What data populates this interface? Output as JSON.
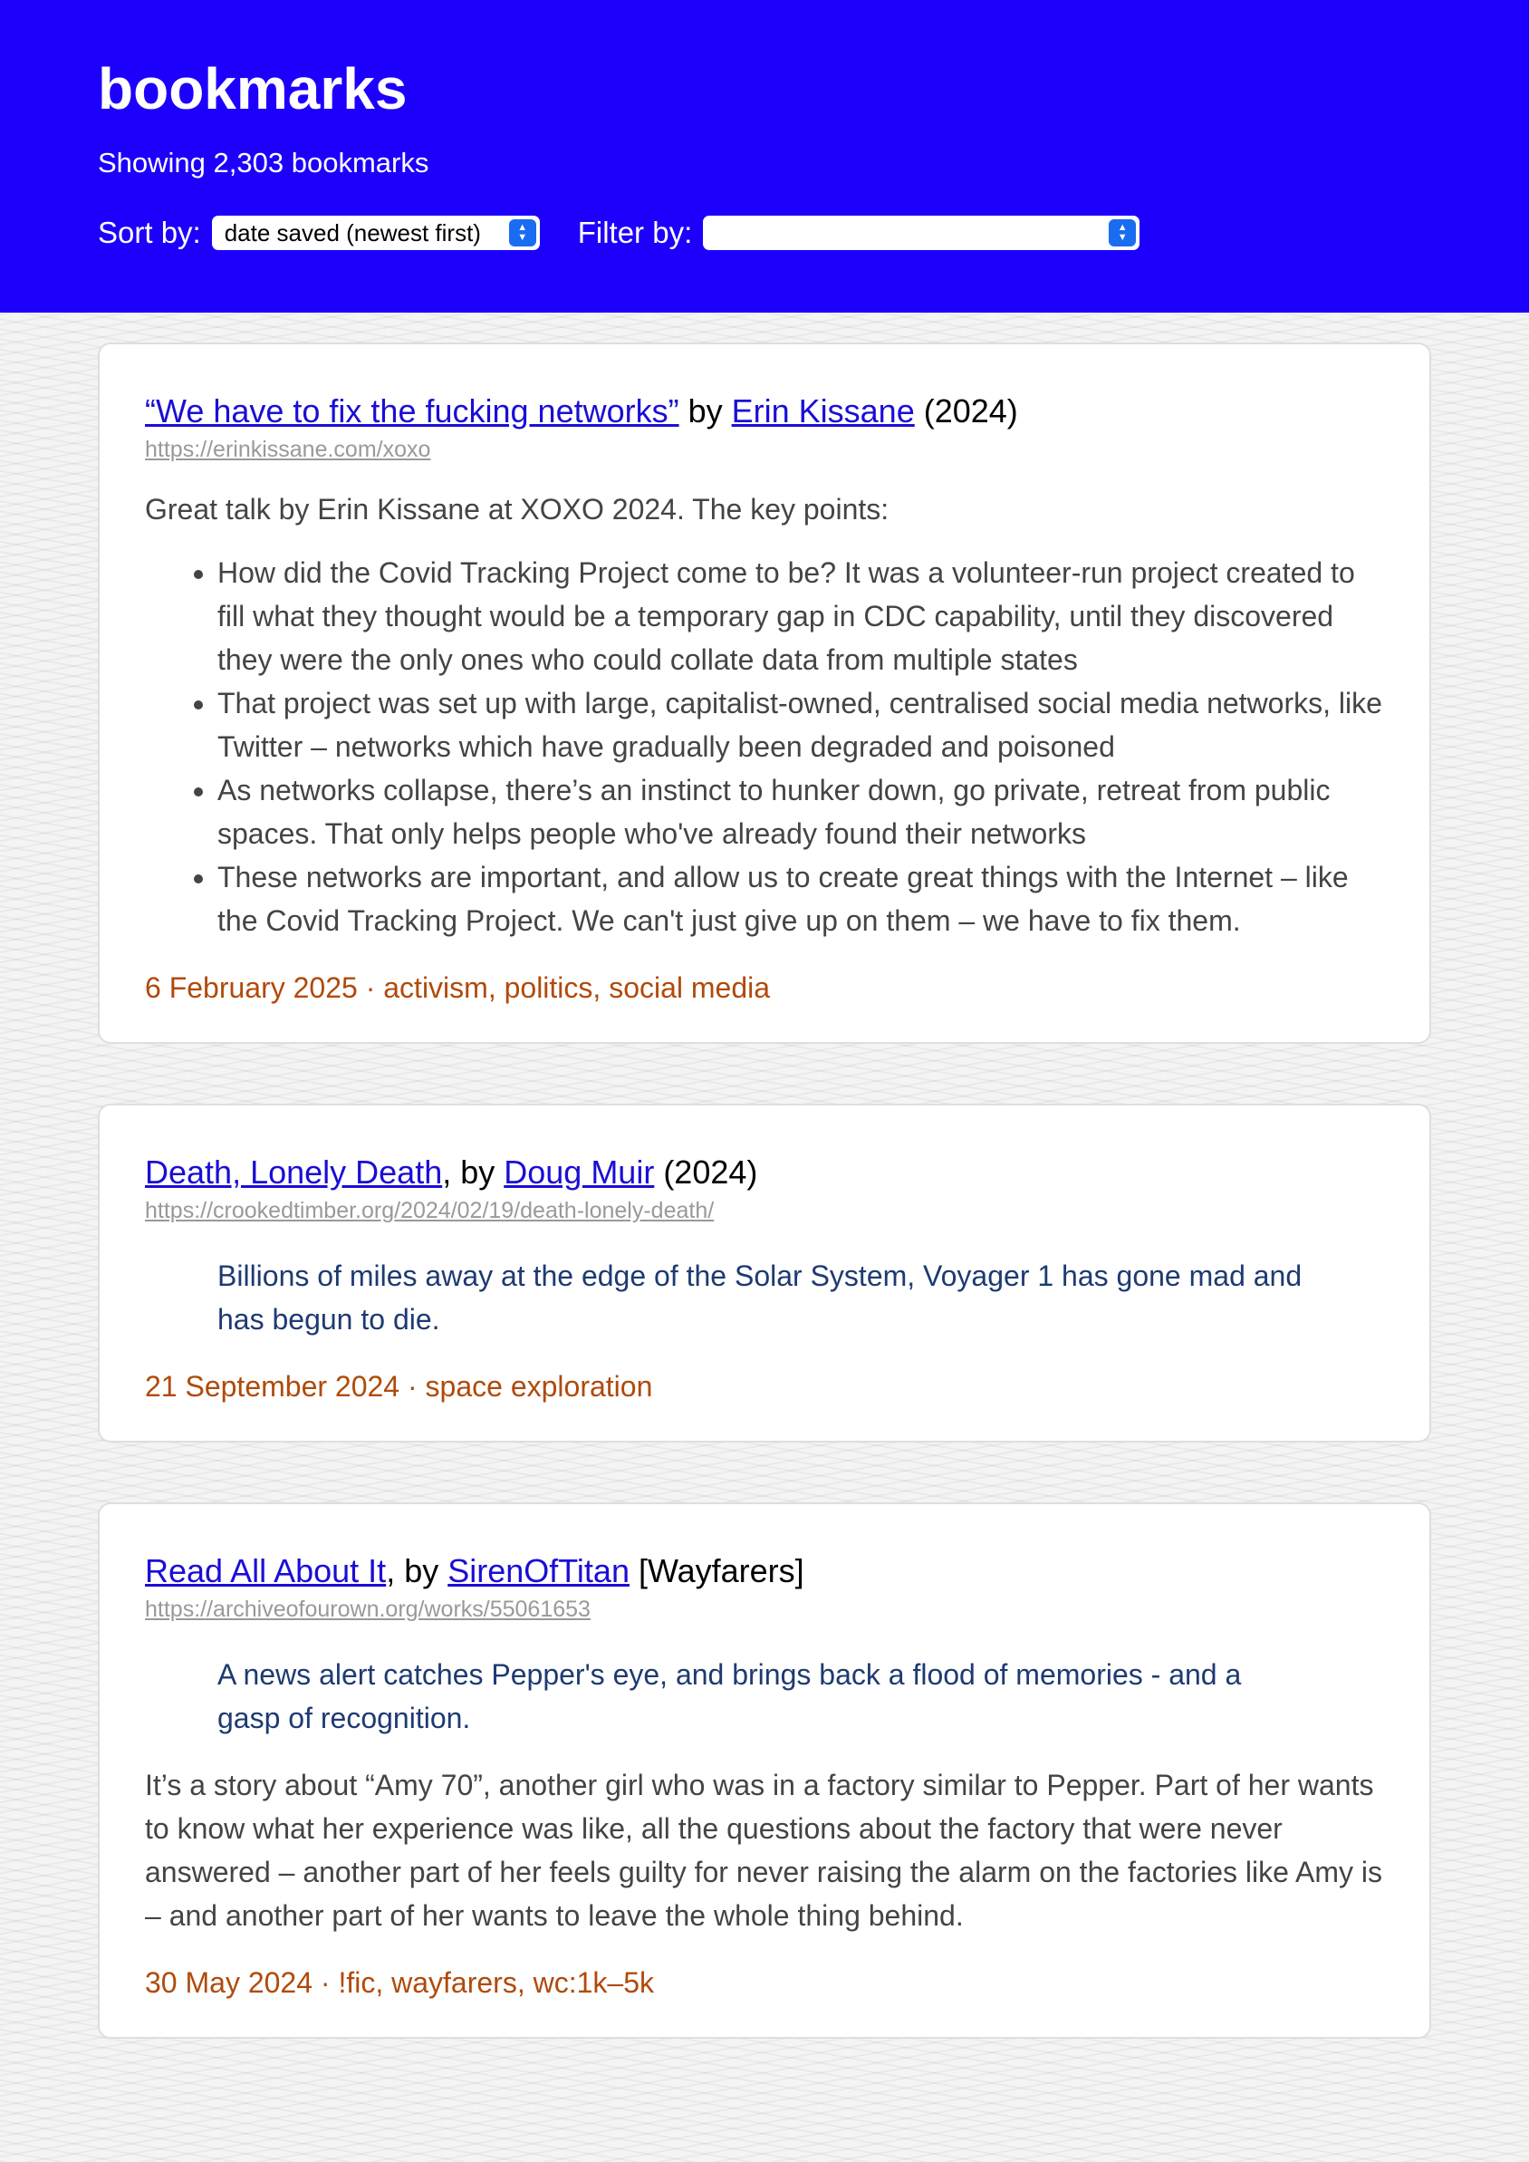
{
  "header": {
    "title": "bookmarks",
    "count_text": "Showing 2,303 bookmarks",
    "sort_label": "Sort by:",
    "sort_value": "date saved (newest first)",
    "filter_label": "Filter by:",
    "filter_value": ""
  },
  "colors": {
    "header_bg": "#1d00fb",
    "link": "#1a0dd6",
    "meta": "#b04a0a",
    "quote": "#1e3a72"
  },
  "bookmarks": [
    {
      "title": "“We have to fix the fucking networks”",
      "by": " by ",
      "author": "Erin Kissane",
      "suffix": " (2024)",
      "url": "https://erinkissane.com/xoxo",
      "description": "Great talk by Erin Kissane at XOXO 2024. The key points:",
      "points": [
        "How did the Covid Tracking Project come to be? It was a volunteer-run project created to fill what they thought would be a temporary gap in CDC capability, until they discovered they were the only ones who could collate data from multiple states",
        "That project was set up with large, capitalist-owned, centralised social media networks, like Twitter – networks which have gradually been degraded and poisoned",
        "As networks collapse, there’s an instinct to hunker down, go private, retreat from public spaces. That only helps people who've already found their networks",
        "These networks are important, and allow us to create great things with the Internet – like the Covid Tracking Project. We can't just give up on them – we have to fix them."
      ],
      "meta": "6 February 2025 · activism, politics, social media"
    },
    {
      "title": "Death, Lonely Death",
      "by": ", by ",
      "author": "Doug Muir",
      "suffix": " (2024)",
      "url": "https://crookedtimber.org/2024/02/19/death-lonely-death/",
      "quote": "Billions of miles away at the edge of the Solar System, Voyager 1 has gone mad and has begun to die.",
      "meta": "21 September 2024 · space exploration"
    },
    {
      "title": "Read All About It",
      "by": ", by ",
      "author": "SirenOfTitan",
      "suffix": " [Wayfarers]",
      "url": "https://archiveofourown.org/works/55061653",
      "quote": "A news alert catches Pepper's eye, and brings back a flood of memories - and a gasp of recognition.",
      "description": "It’s a story about “Amy 70”, another girl who was in a factory similar to Pepper. Part of her wants to know what her experience was like, all the questions about the factory that were never answered – another part of her feels guilty for never raising the alarm on the factories like Amy is – and another part of her wants to leave the whole thing behind.",
      "meta": "30 May 2024 · !fic, wayfarers, wc:1k–5k"
    }
  ]
}
